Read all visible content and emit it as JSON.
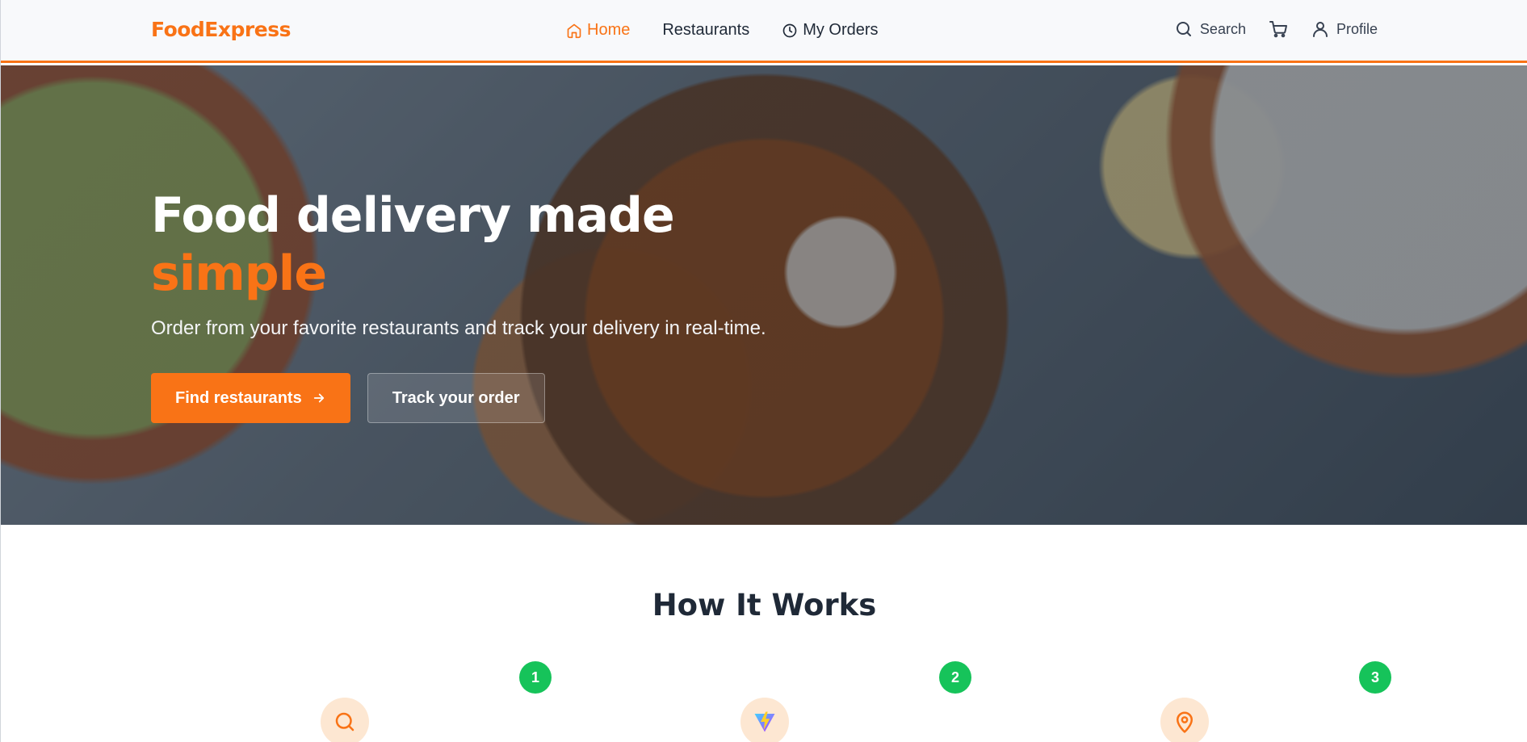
{
  "nav": {
    "logo": "FoodExpress",
    "links": [
      {
        "label": "Home",
        "icon": "home-icon",
        "active": true
      },
      {
        "label": "Restaurants",
        "icon": "",
        "active": false
      },
      {
        "label": "My Orders",
        "icon": "clock-icon",
        "active": false
      }
    ],
    "search_label": "Search",
    "profile_label": "Profile"
  },
  "hero": {
    "title_main": "Food delivery made ",
    "title_accent": "simple",
    "subtitle": "Order from your favorite restaurants and track your delivery in real-time.",
    "primary_button": "Find restaurants",
    "secondary_button": "Track your order"
  },
  "how_it_works": {
    "title": "How It Works",
    "steps": [
      {
        "number": "1",
        "icon": "search-icon"
      },
      {
        "number": "2",
        "icon": "vite-logo-icon"
      },
      {
        "number": "3",
        "icon": "map-pin-icon"
      }
    ]
  },
  "colors": {
    "accent": "#f97316",
    "badge": "#16c35a",
    "icon_bg": "#fde7d2",
    "text_dark": "#1f2937"
  }
}
